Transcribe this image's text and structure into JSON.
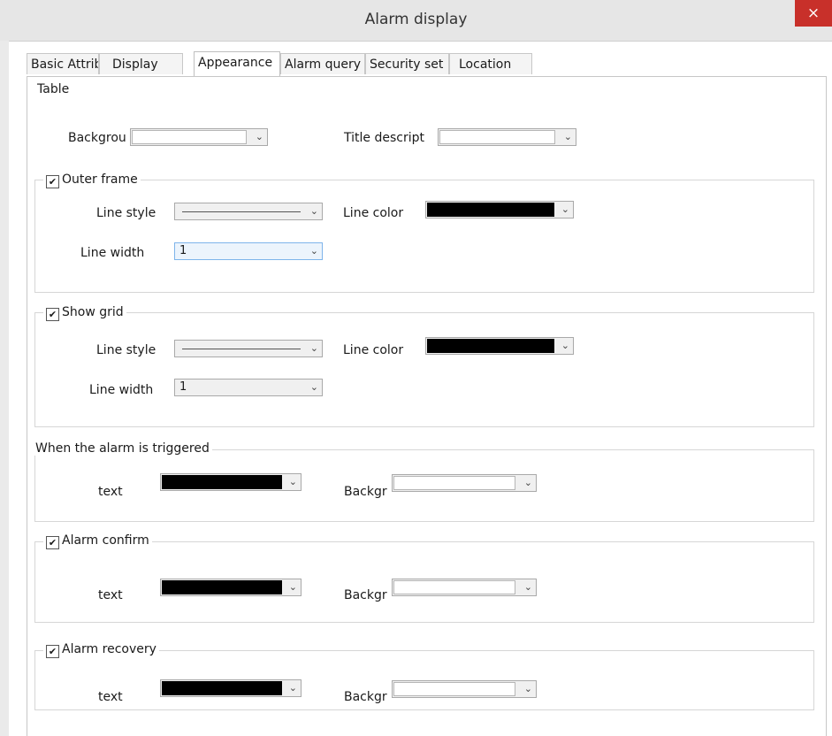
{
  "window": {
    "title": "Alarm display",
    "close_glyph": "×"
  },
  "tabs": [
    "Basic Attribu",
    "Display",
    "Appearance",
    "Alarm query",
    "Security set",
    "Location"
  ],
  "table_section": {
    "label": "Table",
    "background_label": "Backgrou",
    "title_label": "Title descript"
  },
  "outer_frame": {
    "label": "Outer frame",
    "checked": true,
    "line_style_label": "Line style",
    "line_color_label": "Line color",
    "line_width_label": "Line width",
    "line_width_value": "1"
  },
  "show_grid": {
    "label": "Show grid",
    "checked": true,
    "line_style_label": "Line style",
    "line_color_label": "Line color",
    "line_width_label": "Line width",
    "line_width_value": "1"
  },
  "alarm_triggered": {
    "label": "When the alarm is triggered",
    "text_label": "text",
    "background_label": "Backgr"
  },
  "alarm_confirm": {
    "label": "Alarm confirm",
    "checked": true,
    "text_label": "text",
    "background_label": "Backgr"
  },
  "alarm_recovery": {
    "label": "Alarm recovery",
    "checked": true,
    "text_label": "text",
    "background_label": "Backgr"
  },
  "glyphs": {
    "check": "✔",
    "arrow": "⌄"
  },
  "colors": {
    "close_button": "#c8302a",
    "swatch_black": "#000000",
    "swatch_white": "#ffffff"
  }
}
